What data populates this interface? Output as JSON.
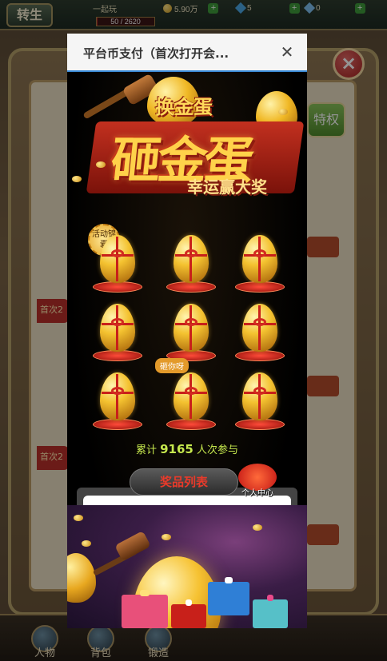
{
  "game": {
    "rebirth_label": "转生",
    "player_text": "一起玩",
    "xp_text": "50 / 2620",
    "xp_progress": 0.02,
    "resources": [
      {
        "icon": "coin-icon",
        "value": "5.90万"
      },
      {
        "icon": "gem-icon",
        "value": "5"
      },
      {
        "icon": "ticket-icon",
        "value": "0"
      }
    ],
    "privilege_label": "特权",
    "side_tags": [
      "首次2",
      "首次2"
    ],
    "bottom_nav": [
      "人物",
      "背包",
      "锻造"
    ]
  },
  "modal": {
    "title": "平台币支付（首次打开会...",
    "close_glyph": "✕",
    "banner": {
      "exchange_tag": "换金蛋",
      "main_title": "砸金蛋",
      "subtitle": "幸运赢大奖"
    },
    "activity_badge": "活动锦囊",
    "hammer_tag": "砸你呀",
    "participation": {
      "prefix": "累计",
      "count": "9165",
      "suffix": "人次参与"
    },
    "prize_list_label": "奖品列表",
    "personal_center_label": "个人中心",
    "egg_count": 9
  },
  "colors": {
    "accent_gold": "#ffd24a",
    "accent_red": "#c8201a",
    "count_green": "#c6e84e",
    "header_border": "#3a8ad6"
  }
}
